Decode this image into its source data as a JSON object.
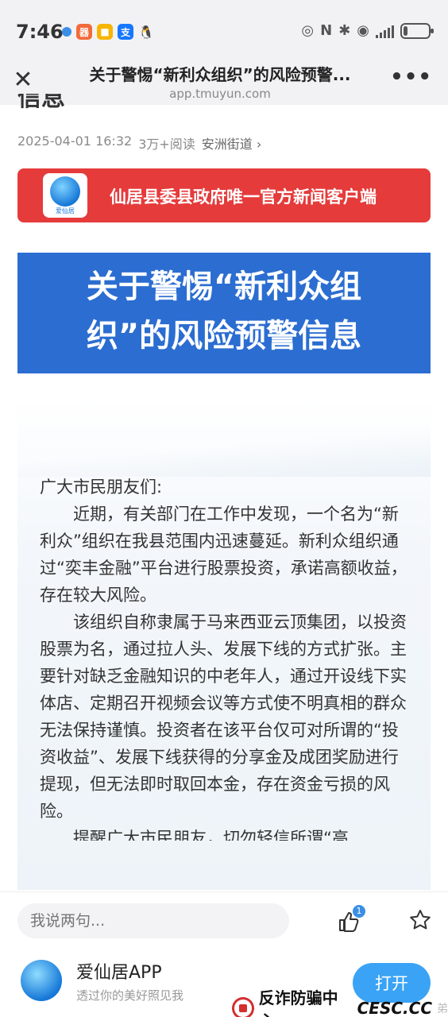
{
  "status_bar": {
    "time": "7:46",
    "battery_level": 0.15,
    "app_icons": [
      {
        "name": "app-icon-1",
        "color": "#3a8ee6",
        "glyph": "•"
      },
      {
        "name": "app-icon-2",
        "color": "#f26b3a",
        "glyph": "器"
      },
      {
        "name": "app-icon-3",
        "color": "#f7b500",
        "glyph": "■"
      },
      {
        "name": "app-icon-4",
        "color": "#1677ff",
        "glyph": "支"
      },
      {
        "name": "app-icon-5",
        "color": "#111111",
        "glyph": "🐧"
      }
    ]
  },
  "title_bar": {
    "title": "关于警惕“新利众组织”的风险预警...",
    "url": "app.tmuyun.com",
    "close_icon": "close-icon",
    "more_icon": "more-icon"
  },
  "article": {
    "cut_title": "信息",
    "date": "2025-04-01 16:32",
    "reads": "3万+阅读",
    "source": "安洲街道 ›",
    "red_banner_text": "仙居县委县政府唯一官方新闻客户端",
    "red_banner_logo_caption": "爱仙居",
    "headline_line1": "关于警惕“新利众组",
    "headline_line2": "织”的风险预警信息",
    "greeting": "广大市民朋友们:",
    "para1": "近期，有关部门在工作中发现，一个名为“新利众”组织在我县范围内迅速蔓延。新利众组织通过“奕丰金融”平台进行股票投资，承诺高额收益，存在较大风险。",
    "para2": "该组织自称隶属于马来西亚云顶集团，以投资股票为名，通过拉人头、发展下线的方式扩张。主要针对缺乏金融知识的中老年人，通过开设线下实体店、定期召开视频会议等方式使不明真相的群众无法保持谨慎。投资者在该平台仅可对所谓的“投资收益”、发展下线获得的分享金及成团奖励进行提现，但无法即时取回本金，存在资金亏损的风险。",
    "para3_partial": "提醒广大市民朋友，切勿轻信所谓“高"
  },
  "comment_bar": {
    "placeholder": "我说两句...",
    "like_count": "1"
  },
  "promo": {
    "app_name": "爱仙居APP",
    "slogan": "透过你的美好照见我",
    "open_label": "打开"
  },
  "watermark": {
    "text": "反诈防骗中心",
    "site": "CESC.CC",
    "tail": "弟"
  }
}
